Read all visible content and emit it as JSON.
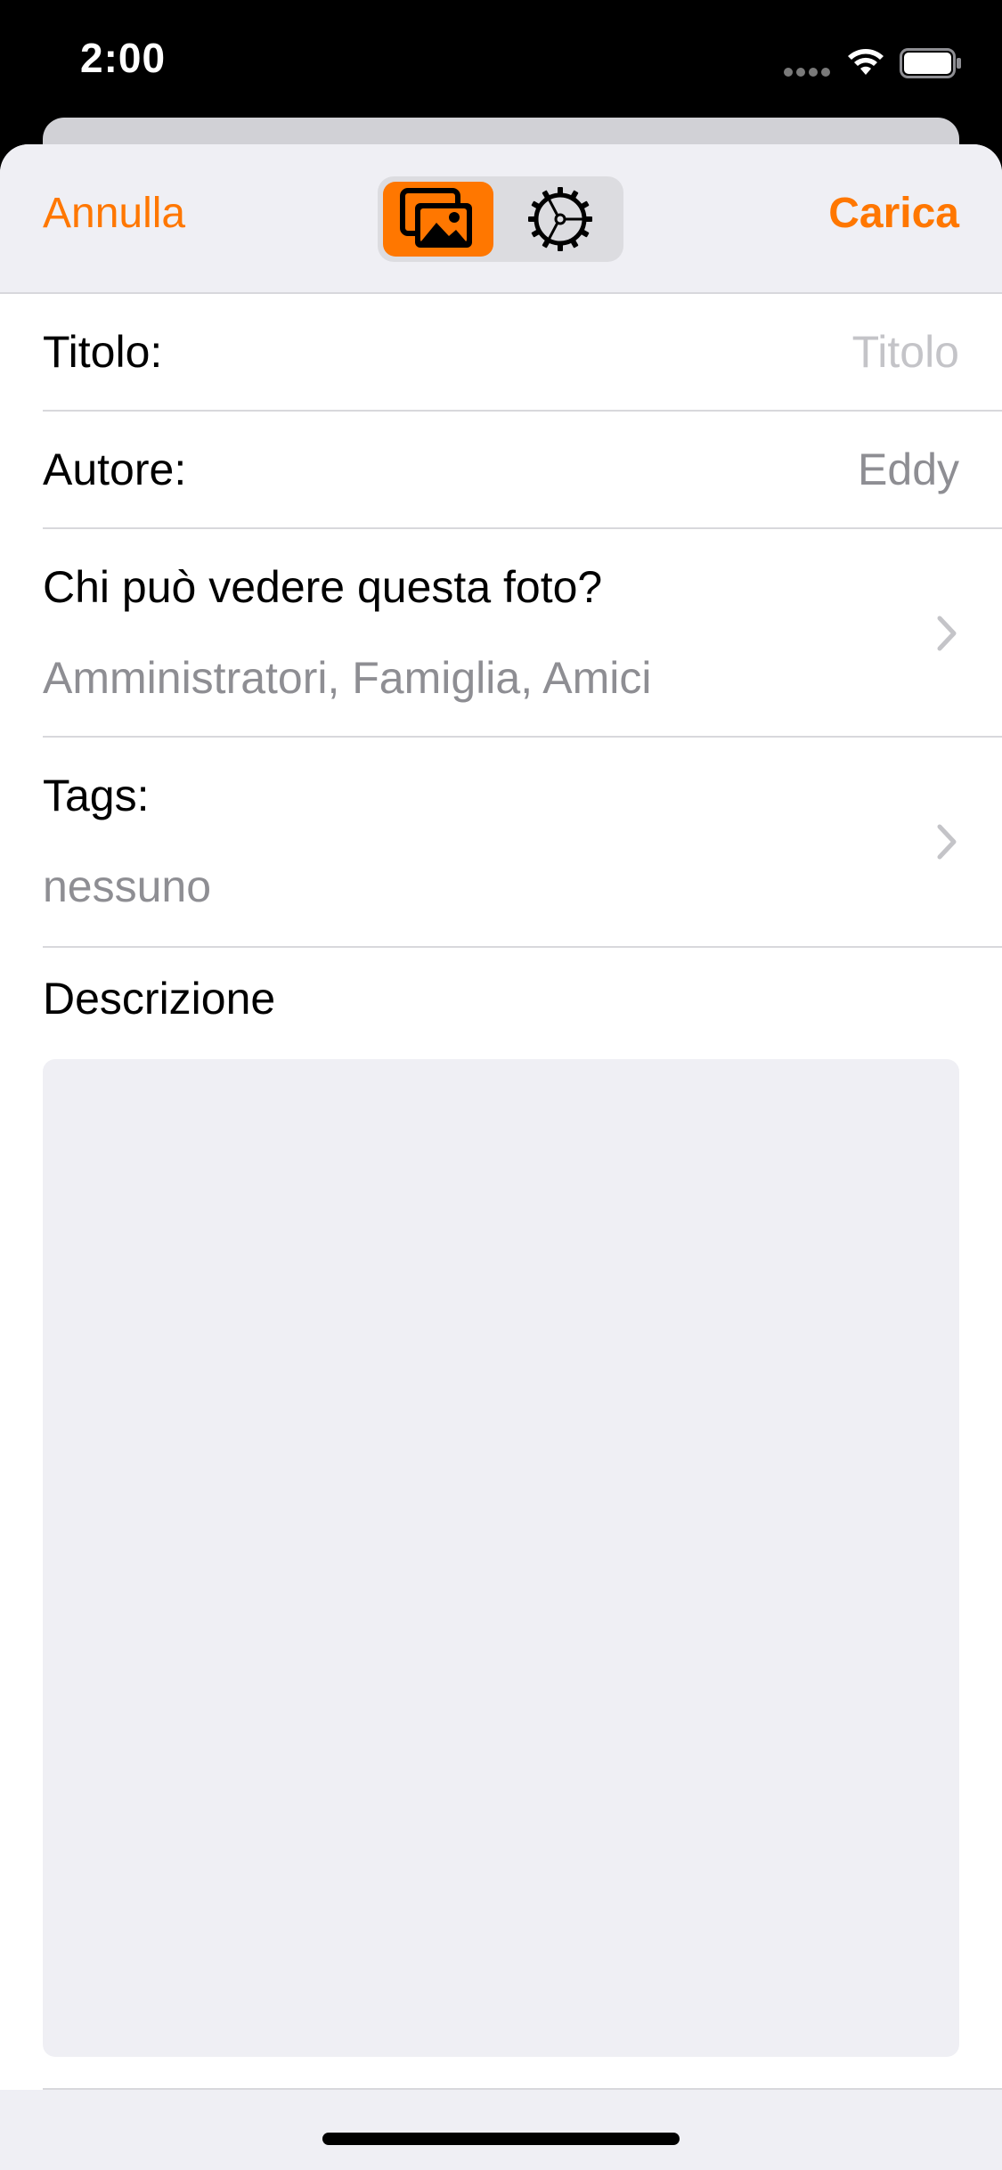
{
  "status_bar": {
    "time": "2:00"
  },
  "nav": {
    "cancel_label": "Annulla",
    "upload_label": "Carica",
    "segments": [
      {
        "icon": "photos-icon",
        "selected": true
      },
      {
        "icon": "settings-gear-icon",
        "selected": false
      }
    ]
  },
  "form": {
    "title": {
      "label": "Titolo:",
      "placeholder": "Titolo",
      "value": ""
    },
    "author": {
      "label": "Autore:",
      "value": "Eddy"
    },
    "privacy": {
      "label": "Chi può vedere questa foto?",
      "value": "Amministratori, Famiglia, Amici"
    },
    "tags": {
      "label": "Tags:",
      "value": "nessuno"
    },
    "description": {
      "label": "Descrizione",
      "value": ""
    }
  },
  "colors": {
    "accent": "#ff7700",
    "secondary_text": "#8e8e93",
    "placeholder_text": "#c4c4c8",
    "grouped_background": "#efeff4",
    "separator": "#d8d8dc"
  }
}
